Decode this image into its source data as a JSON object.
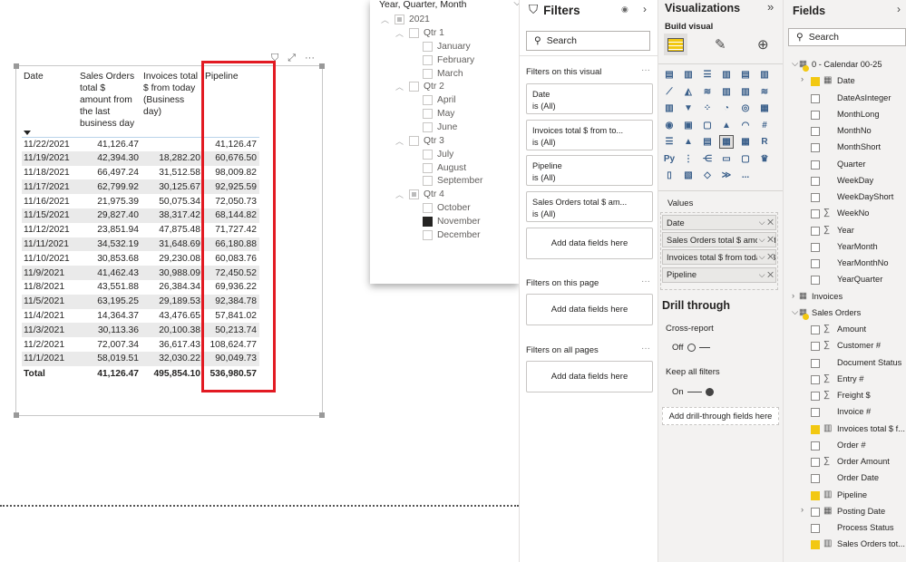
{
  "table": {
    "columns": [
      "Date",
      "Sales Orders total $ amount from the last business day",
      "Invoices total $ from today (Business day)",
      "Pipeline"
    ],
    "rows": [
      [
        "11/22/2021",
        "41,126.47",
        "",
        "41,126.47"
      ],
      [
        "11/19/2021",
        "42,394.30",
        "18,282.20",
        "60,676.50"
      ],
      [
        "11/18/2021",
        "66,497.24",
        "31,512.58",
        "98,009.82"
      ],
      [
        "11/17/2021",
        "62,799.92",
        "30,125.67",
        "92,925.59"
      ],
      [
        "11/16/2021",
        "21,975.39",
        "50,075.34",
        "72,050.73"
      ],
      [
        "11/15/2021",
        "29,827.40",
        "38,317.42",
        "68,144.82"
      ],
      [
        "11/12/2021",
        "23,851.94",
        "47,875.48",
        "71,727.42"
      ],
      [
        "11/11/2021",
        "34,532.19",
        "31,648.69",
        "66,180.88"
      ],
      [
        "11/10/2021",
        "30,853.68",
        "29,230.08",
        "60,083.76"
      ],
      [
        "11/9/2021",
        "41,462.43",
        "30,988.09",
        "72,450.52"
      ],
      [
        "11/8/2021",
        "43,551.88",
        "26,384.34",
        "69,936.22"
      ],
      [
        "11/5/2021",
        "63,195.25",
        "29,189.53",
        "92,384.78"
      ],
      [
        "11/4/2021",
        "14,364.37",
        "43,476.65",
        "57,841.02"
      ],
      [
        "11/3/2021",
        "30,113.36",
        "20,100.38",
        "50,213.74"
      ],
      [
        "11/2/2021",
        "72,007.34",
        "36,617.43",
        "108,624.77"
      ],
      [
        "11/1/2021",
        "58,019.51",
        "32,030.22",
        "90,049.73"
      ]
    ],
    "total": [
      "Total",
      "41,126.47",
      "495,854.10",
      "536,980.57"
    ],
    "highlight_color": "#e21a22"
  },
  "slicer": {
    "title": "Year, Quarter, Month",
    "year": "2021",
    "quarters": [
      {
        "label": "Qtr 1",
        "months": [
          "January",
          "February",
          "March"
        ]
      },
      {
        "label": "Qtr 2",
        "months": [
          "April",
          "May",
          "June"
        ]
      },
      {
        "label": "Qtr 3",
        "months": [
          "July",
          "August",
          "September"
        ]
      },
      {
        "label": "Qtr 4",
        "months": [
          "October",
          "November",
          "December"
        ]
      }
    ],
    "selected_month": "November"
  },
  "filters": {
    "title": "Filters",
    "search_placeholder": "Search",
    "on_visual": "Filters on this visual",
    "cards": [
      {
        "name": "Date",
        "state": "is (All)"
      },
      {
        "name": "Invoices total $ from to...",
        "state": "is (All)"
      },
      {
        "name": "Pipeline",
        "state": "is (All)"
      },
      {
        "name": "Sales Orders total $ am...",
        "state": "is (All)"
      }
    ],
    "add_fields": "Add data fields here",
    "on_page": "Filters on this page",
    "on_all": "Filters on all pages"
  },
  "viz": {
    "title": "Visualizations",
    "build": "Build visual",
    "values_label": "Values",
    "wells": [
      "Date",
      "Sales Orders total $ amount from the last business day",
      "Invoices total $ from today (Business day)",
      "Pipeline"
    ],
    "drill": "Drill through",
    "cross": "Cross-report",
    "cross_state": "Off",
    "keep": "Keep all filters",
    "keep_state": "On",
    "add_drill": "Add drill-through fields here",
    "more": "..."
  },
  "fields": {
    "title": "Fields",
    "search_placeholder": "Search",
    "items": [
      {
        "label": "0 - Calendar 00-25",
        "type": "table",
        "level": 0,
        "expanded": true
      },
      {
        "label": "Date",
        "type": "date",
        "level": 1,
        "checked": true,
        "expandable": true
      },
      {
        "label": "DateAsInteger",
        "type": "",
        "level": 1
      },
      {
        "label": "MonthLong",
        "type": "",
        "level": 1
      },
      {
        "label": "MonthNo",
        "type": "",
        "level": 1
      },
      {
        "label": "MonthShort",
        "type": "",
        "level": 1
      },
      {
        "label": "Quarter",
        "type": "",
        "level": 1
      },
      {
        "label": "WeekDay",
        "type": "",
        "level": 1
      },
      {
        "label": "WeekDayShort",
        "type": "",
        "level": 1
      },
      {
        "label": "WeekNo",
        "type": "sum",
        "level": 1
      },
      {
        "label": "Year",
        "type": "sum",
        "level": 1
      },
      {
        "label": "YearMonth",
        "type": "",
        "level": 1
      },
      {
        "label": "YearMonthNo",
        "type": "",
        "level": 1
      },
      {
        "label": "YearQuarter",
        "type": "",
        "level": 1
      },
      {
        "label": "Invoices",
        "type": "table",
        "level": 0,
        "expanded": false
      },
      {
        "label": "Sales Orders",
        "type": "table",
        "level": 0,
        "expanded": true
      },
      {
        "label": "Amount",
        "type": "sum",
        "level": 1
      },
      {
        "label": "Customer #",
        "type": "sum",
        "level": 1
      },
      {
        "label": "Document Status",
        "type": "",
        "level": 1
      },
      {
        "label": "Entry #",
        "type": "sum",
        "level": 1
      },
      {
        "label": "Freight $",
        "type": "sum",
        "level": 1
      },
      {
        "label": "Invoice #",
        "type": "",
        "level": 1
      },
      {
        "label": "Invoices total $ f...",
        "type": "measure",
        "level": 1,
        "checked": true
      },
      {
        "label": "Order #",
        "type": "",
        "level": 1
      },
      {
        "label": "Order Amount",
        "type": "sum",
        "level": 1
      },
      {
        "label": "Order Date",
        "type": "",
        "level": 1
      },
      {
        "label": "Pipeline",
        "type": "measure",
        "level": 1,
        "checked": true
      },
      {
        "label": "Posting Date",
        "type": "date",
        "level": 1,
        "expandable": true
      },
      {
        "label": "Process Status",
        "type": "",
        "level": 1
      },
      {
        "label": "Sales Orders tot...",
        "type": "measure",
        "level": 1,
        "checked": true
      }
    ],
    "accent": "#f2c811"
  }
}
